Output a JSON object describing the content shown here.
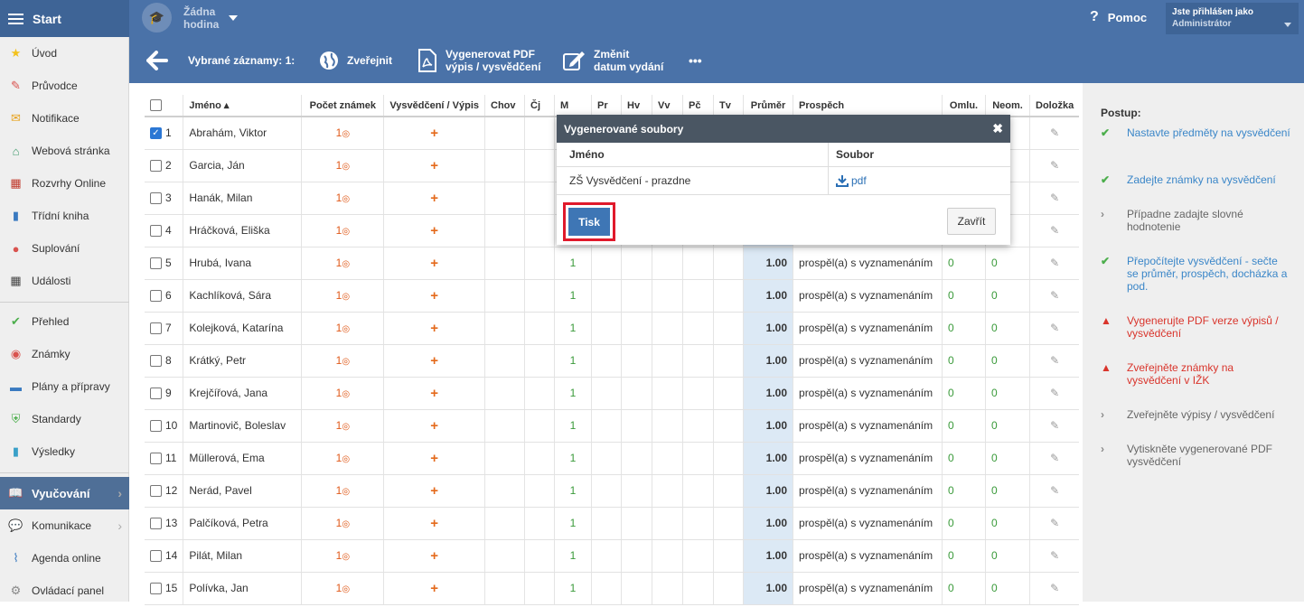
{
  "topbar": {
    "start": "Start",
    "lesson": "Žádna hodina",
    "help": "Pomoc",
    "user_label": "Jste přihlášen jako",
    "user_role": "Administrátor"
  },
  "sidebar": {
    "items": [
      "Úvod",
      "Průvodce",
      "Notifikace",
      "Webová stránka",
      "Rozvrhy Online",
      "Třídní kniha",
      "Suplování",
      "Události",
      "Přehled",
      "Známky",
      "Plány a přípravy",
      "Standardy",
      "Výsledky",
      "Vyučování",
      "Komunikace",
      "Agenda online",
      "Ovládací panel"
    ]
  },
  "toolbar": {
    "selected": "Vybrané záznamy: 1:",
    "publish": "Zveřejnit",
    "gen_line1": "Vygenerovat PDF",
    "gen_line2": "výpis / vysvědčení",
    "change_line1": "Změnit",
    "change_line2": "datum vydání",
    "more": "•••"
  },
  "table": {
    "headers": [
      "Jméno ▴",
      "Počet známek",
      "Vysvědčení / Výpis",
      "Chov",
      "Čj",
      "M",
      "Pr",
      "Hv",
      "Vv",
      "Pč",
      "Tv",
      "Průměr",
      "Prospěch",
      "Omlu.",
      "Neom.",
      "Doložka"
    ],
    "rows": [
      {
        "n": "1",
        "name": "Abrahám, Viktor",
        "cnt": "1",
        "checked": true
      },
      {
        "n": "2",
        "name": "Garcia, Ján",
        "cnt": "1"
      },
      {
        "n": "3",
        "name": "Hanák, Milan",
        "cnt": "1"
      },
      {
        "n": "4",
        "name": "Hráčková, Eliška",
        "cnt": "1"
      },
      {
        "n": "5",
        "name": "Hrubá, Ivana",
        "cnt": "1",
        "m": "1",
        "avg": "1.00",
        "grade": "prospěl(a) s vyznamenáním",
        "om": "0",
        "ne": "0"
      },
      {
        "n": "6",
        "name": "Kachlíková, Sára",
        "cnt": "1",
        "m": "1",
        "avg": "1.00",
        "grade": "prospěl(a) s vyznamenáním",
        "om": "0",
        "ne": "0"
      },
      {
        "n": "7",
        "name": "Kolejková, Katarína",
        "cnt": "1",
        "m": "1",
        "avg": "1.00",
        "grade": "prospěl(a) s vyznamenáním",
        "om": "0",
        "ne": "0"
      },
      {
        "n": "8",
        "name": "Krátký, Petr",
        "cnt": "1",
        "m": "1",
        "avg": "1.00",
        "grade": "prospěl(a) s vyznamenáním",
        "om": "0",
        "ne": "0"
      },
      {
        "n": "9",
        "name": "Krejčířová, Jana",
        "cnt": "1",
        "m": "1",
        "avg": "1.00",
        "grade": "prospěl(a) s vyznamenáním",
        "om": "0",
        "ne": "0"
      },
      {
        "n": "10",
        "name": "Martinovič, Boleslav",
        "cnt": "1",
        "m": "1",
        "avg": "1.00",
        "grade": "prospěl(a) s vyznamenáním",
        "om": "0",
        "ne": "0"
      },
      {
        "n": "11",
        "name": "Müllerová, Ema",
        "cnt": "1",
        "m": "1",
        "avg": "1.00",
        "grade": "prospěl(a) s vyznamenáním",
        "om": "0",
        "ne": "0"
      },
      {
        "n": "12",
        "name": "Nerád, Pavel",
        "cnt": "1",
        "m": "1",
        "avg": "1.00",
        "grade": "prospěl(a) s vyznamenáním",
        "om": "0",
        "ne": "0"
      },
      {
        "n": "13",
        "name": "Palčíková, Petra",
        "cnt": "1",
        "m": "1",
        "avg": "1.00",
        "grade": "prospěl(a) s vyznamenáním",
        "om": "0",
        "ne": "0"
      },
      {
        "n": "14",
        "name": "Pilát, Milan",
        "cnt": "1",
        "m": "1",
        "avg": "1.00",
        "grade": "prospěl(a) s vyznamenáním",
        "om": "0",
        "ne": "0"
      },
      {
        "n": "15",
        "name": "Polívka, Jan",
        "cnt": "1",
        "m": "1",
        "avg": "1.00",
        "grade": "prospěl(a) s vyznamenáním",
        "om": "0",
        "ne": "0"
      }
    ]
  },
  "postup": {
    "title": "Postup:",
    "steps": [
      {
        "text": "Nastavte předměty na vysvědčení",
        "state": "done"
      },
      {
        "text": "Zadejte známky na vysvědčení",
        "state": "done"
      },
      {
        "text": "Případne zadajte slovné hodnotenie",
        "state": "todo"
      },
      {
        "text": "Přepočítejte vysvědčení - sečte se průměr, prospěch, docházka a pod.",
        "state": "done"
      },
      {
        "text": "Vygenerujte PDF verze výpisů / vysvědčení",
        "state": "warn"
      },
      {
        "text": "Zveřejněte známky na vysvědčení v IŽK",
        "state": "warn"
      },
      {
        "text": "Zveřejněte výpisy / vysvědčení",
        "state": "todo"
      },
      {
        "text": "Vytiskněte vygenerované PDF vysvědčení",
        "state": "todo"
      }
    ]
  },
  "modal": {
    "title": "Vygenerované soubory",
    "col_name": "Jméno",
    "col_file": "Soubor",
    "file_name": "ZŠ Vysvědčení - prazdne",
    "file_link": "pdf",
    "print": "Tisk",
    "close": "Zavřít"
  }
}
